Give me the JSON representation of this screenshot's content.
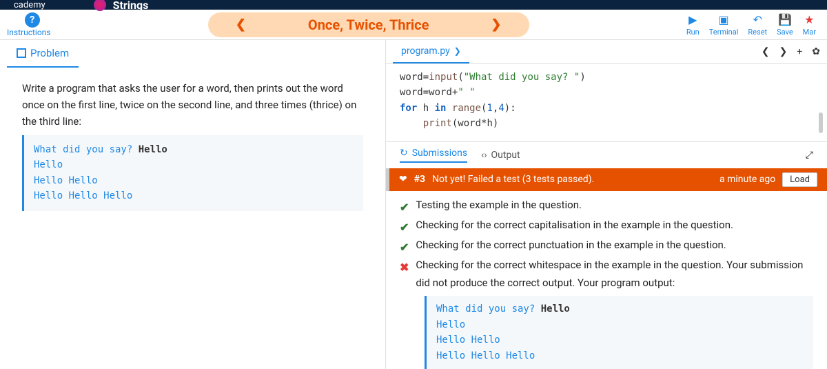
{
  "topbar": {
    "brand_left": "cademy",
    "brand_right": "Strings"
  },
  "header": {
    "help_char": "?",
    "instructions_label": "Instructions",
    "prev": "❮",
    "title": "Once, Twice, Thrice",
    "next": "❯",
    "toolbar": {
      "run": "Run",
      "terminal": "Terminal",
      "reset": "Reset",
      "save": "Save",
      "mark": "Mar",
      "run_glyph": "▶",
      "term_glyph": "▣",
      "undo_glyph": "↶",
      "save_glyph": "💾",
      "star_glyph": "★"
    }
  },
  "problem": {
    "tab_label": "Problem",
    "text": "Write a program that asks the user for a word, then prints out the word once on the first line, twice on the second line, and three times (thrice) on the third line:",
    "example": {
      "prompt": "What did you say? ",
      "input": "Hello",
      "l1": "Hello",
      "l2": "Hello Hello",
      "l3": "Hello Hello Hello"
    }
  },
  "editor": {
    "filename": "program.py",
    "chev": "❯",
    "tools": {
      "prev": "❮",
      "next": "❯",
      "add": "+",
      "settings": "✿"
    },
    "code": {
      "l1_a": "word",
      "l1_b": "=",
      "l1_c": "input",
      "l1_d": "(",
      "l1_e": "\"What did you say? \"",
      "l1_f": ")",
      "l2_a": "word",
      "l2_b": "=",
      "l2_c": "word",
      "l2_d": "+",
      "l2_e": "\" \"",
      "l3_a": "for",
      "l3_b": " h ",
      "l3_c": "in",
      "l3_d": " ",
      "l3_e": "range",
      "l3_f": "(",
      "l3_g": "1",
      "l3_h": ",",
      "l3_i": "4",
      "l3_j": "):",
      "l4_a": "    ",
      "l4_b": "print",
      "l4_c": "(word*h)"
    }
  },
  "bottom": {
    "tab_submissions": "Submissions",
    "tab_output": "Output",
    "sub_glyph": "↻",
    "out_glyph": "‹›",
    "expand_glyph": "⤢",
    "result": {
      "chev": "❤",
      "id": "#3",
      "msg": "Not yet! Failed a test (3 tests passed).",
      "time": "a minute ago",
      "load": "Load"
    },
    "tests": [
      {
        "ok": true,
        "text": "Testing the example in the question."
      },
      {
        "ok": true,
        "text": "Checking for the correct capitalisation in the example in the question."
      },
      {
        "ok": true,
        "text": "Checking for the correct punctuation in the example in the question."
      },
      {
        "ok": false,
        "text": "Checking for the correct whitespace in the example in the question. Your submission did not produce the correct output. Your program output:"
      }
    ],
    "output": {
      "prompt": "What did you say? ",
      "input": "Hello",
      "l1": "Hello",
      "l1_trail": " ",
      "l2": "Hello Hello",
      "l2_trail": " ",
      "l3": "Hello Hello Hello",
      "l3_trail": " "
    }
  }
}
